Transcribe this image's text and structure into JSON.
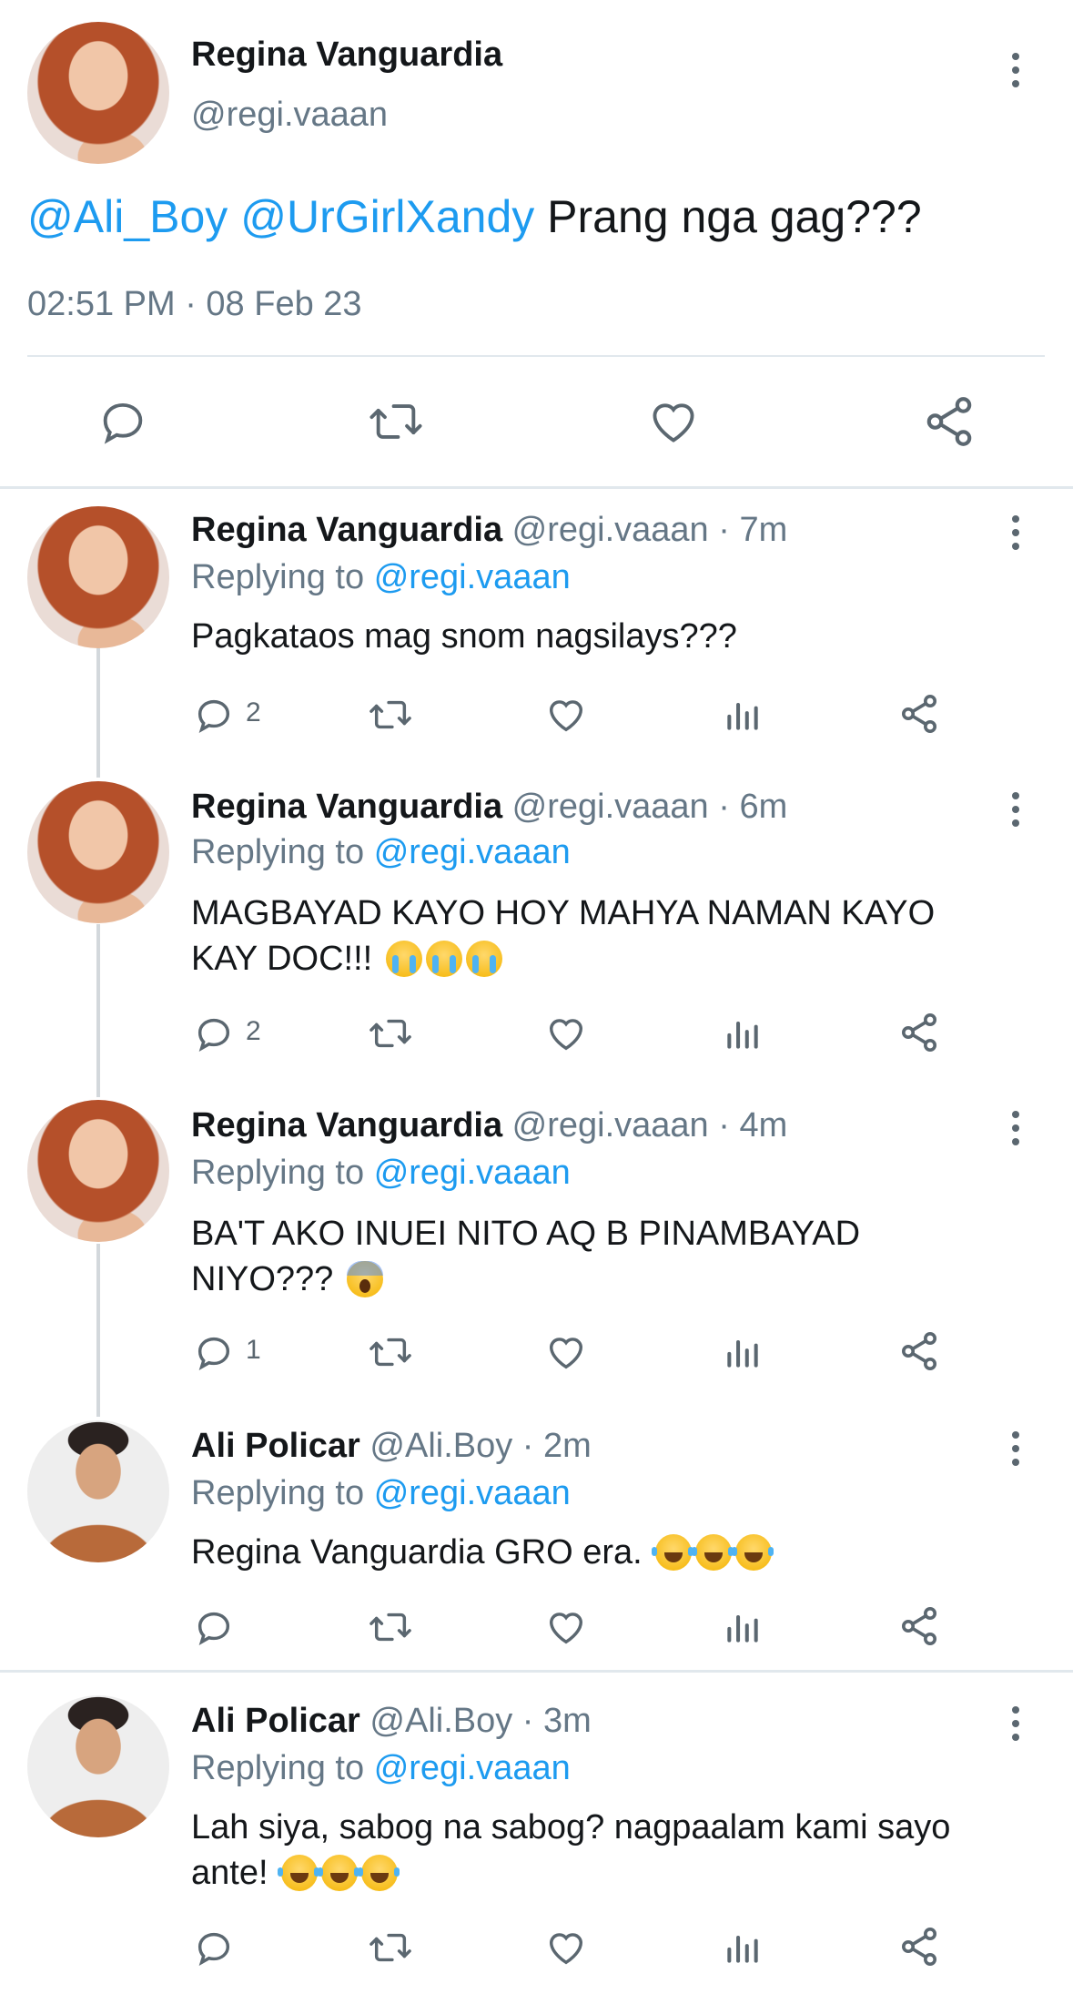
{
  "main_tweet": {
    "author_name": "Regina Vanguardia",
    "author_handle": "@regi.vaaan",
    "mention_1": "@Ali_Boy",
    "mention_2": "@UrGirlXandy",
    "text": "Prang nga gag???",
    "timestamp": "02:51 PM · 08 Feb 23"
  },
  "replies": [
    {
      "author_name": "Regina Vanguardia",
      "handle_time": "@regi.vaaan · 7m",
      "replying_prefix": "Replying to",
      "replying_handle": "@regi.vaaan",
      "text_line_1": "Pagkataos mag snom nagsilays???",
      "text_line_2": "",
      "reply_count": "2"
    },
    {
      "author_name": "Regina Vanguardia",
      "handle_time": "@regi.vaaan · 6m",
      "replying_prefix": "Replying to",
      "replying_handle": "@regi.vaaan",
      "text_line_1": "MAGBAYAD KAYO HOY MAHYA NAMAN KAYO",
      "text_line_2": "KAY DOC!!!",
      "reply_count": "2"
    },
    {
      "author_name": "Regina Vanguardia",
      "handle_time": "@regi.vaaan · 4m",
      "replying_prefix": "Replying to",
      "replying_handle": "@regi.vaaan",
      "text_line_1": "BA'T AKO INUEI NITO AQ B PINAMBAYAD",
      "text_line_2": "NIYO???",
      "reply_count": "1"
    },
    {
      "author_name": "Ali Policar",
      "handle_time": "@Ali.Boy · 2m",
      "replying_prefix": "Replying to",
      "replying_handle": "@regi.vaaan",
      "text_line_1": "Regina Vanguardia GRO era.",
      "text_line_2": "",
      "reply_count": ""
    },
    {
      "author_name": "Ali Policar",
      "handle_time": "@Ali.Boy · 3m",
      "replying_prefix": "Replying to",
      "replying_handle": "@regi.vaaan",
      "text_line_1": "Lah siya, sabog na sabog? nagpaalam kami sayo",
      "text_line_2": "ante!",
      "reply_count": ""
    }
  ],
  "colors": {
    "link": "#1d9bf0",
    "muted": "#657786",
    "icon": "#5b6770",
    "divider": "#e1e8ed"
  }
}
